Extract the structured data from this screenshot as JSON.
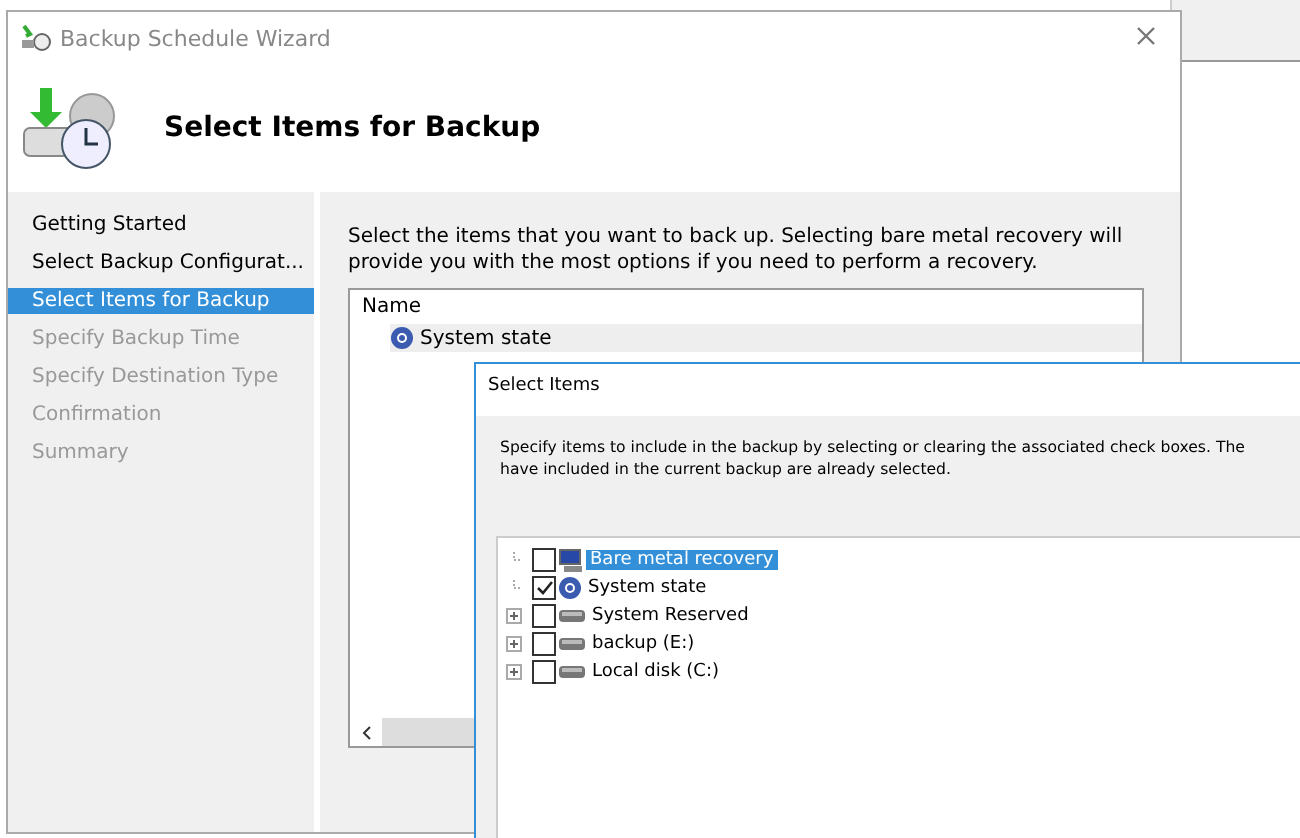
{
  "window": {
    "title": "Backup Schedule Wizard"
  },
  "header": {
    "title": "Select Items for Backup"
  },
  "steps": [
    {
      "label": "Getting Started",
      "selected": false,
      "disabled": false
    },
    {
      "label": "Select Backup Configurat...",
      "selected": false,
      "disabled": false
    },
    {
      "label": "Select Items for Backup",
      "selected": true,
      "disabled": false
    },
    {
      "label": "Specify Backup Time",
      "selected": false,
      "disabled": true
    },
    {
      "label": "Specify Destination Type",
      "selected": false,
      "disabled": true
    },
    {
      "label": "Confirmation",
      "selected": false,
      "disabled": true
    },
    {
      "label": "Summary",
      "selected": false,
      "disabled": true
    }
  ],
  "content": {
    "instructions": "Select the items that you want to back up. Selecting bare metal recovery will provide you with the most options if you need to perform a recovery.",
    "list": {
      "columns": [
        "Name"
      ],
      "rows": [
        {
          "name": "System state"
        }
      ]
    }
  },
  "dialog": {
    "title": "Select Items",
    "instructions": "Specify items to include in the backup by selecting or clearing the associated check boxes. The\nhave included in the current backup are already selected.",
    "tree": [
      {
        "kind": "bmr",
        "label": "Bare metal recovery",
        "checked": false,
        "selected": true,
        "expandable": false
      },
      {
        "kind": "state",
        "label": "System state",
        "checked": true,
        "selected": false,
        "expandable": false
      },
      {
        "kind": "disk",
        "label": "System Reserved",
        "checked": false,
        "selected": false,
        "expandable": true
      },
      {
        "kind": "disk",
        "label": "backup (E:)",
        "checked": false,
        "selected": false,
        "expandable": true
      },
      {
        "kind": "disk",
        "label": "Local disk (C:)",
        "checked": false,
        "selected": false,
        "expandable": true
      }
    ]
  }
}
